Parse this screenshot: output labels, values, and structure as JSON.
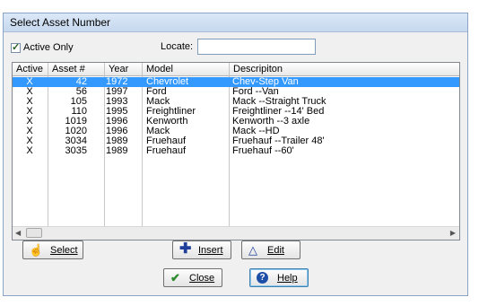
{
  "window": {
    "title": "Select Asset Number"
  },
  "filters": {
    "active_only_label": "Active Only",
    "active_only_checked": true,
    "locate_label": "Locate:",
    "locate_value": ""
  },
  "table": {
    "columns": [
      "Active",
      "Asset #",
      "Year",
      "Model",
      "Descripiton"
    ],
    "rows": [
      {
        "active": "X",
        "asset": "42",
        "year": "1972",
        "model": "Chevrolet",
        "desc": "Chev-Step Van"
      },
      {
        "active": "X",
        "asset": "56",
        "year": "1997",
        "model": "Ford",
        "desc": "Ford --Van"
      },
      {
        "active": "X",
        "asset": "105",
        "year": "1993",
        "model": "Mack",
        "desc": "Mack --Straight Truck"
      },
      {
        "active": "X",
        "asset": "110",
        "year": "1995",
        "model": "Freightliner",
        "desc": "Freightliner --14' Bed"
      },
      {
        "active": "X",
        "asset": "1019",
        "year": "1996",
        "model": "Kenworth",
        "desc": "Kenworth --3 axle"
      },
      {
        "active": "X",
        "asset": "1020",
        "year": "1996",
        "model": "Mack",
        "desc": "Mack --HD"
      },
      {
        "active": "X",
        "asset": "3034",
        "year": "1989",
        "model": "Fruehauf",
        "desc": "Fruehauf --Trailer 48'"
      },
      {
        "active": "X",
        "asset": "3035",
        "year": "1989",
        "model": "Fruehauf",
        "desc": "Fruehauf --60'"
      }
    ],
    "selected_row": 0
  },
  "buttons": {
    "select": "Select",
    "insert": "Insert",
    "edit": "Edit",
    "close": "Close",
    "help": "Help"
  },
  "colors": {
    "selection": "#3399ff",
    "insert_icon": "#1f3f9a",
    "close_icon": "#2e8b2e",
    "help_icon": "#1e4fa8"
  }
}
